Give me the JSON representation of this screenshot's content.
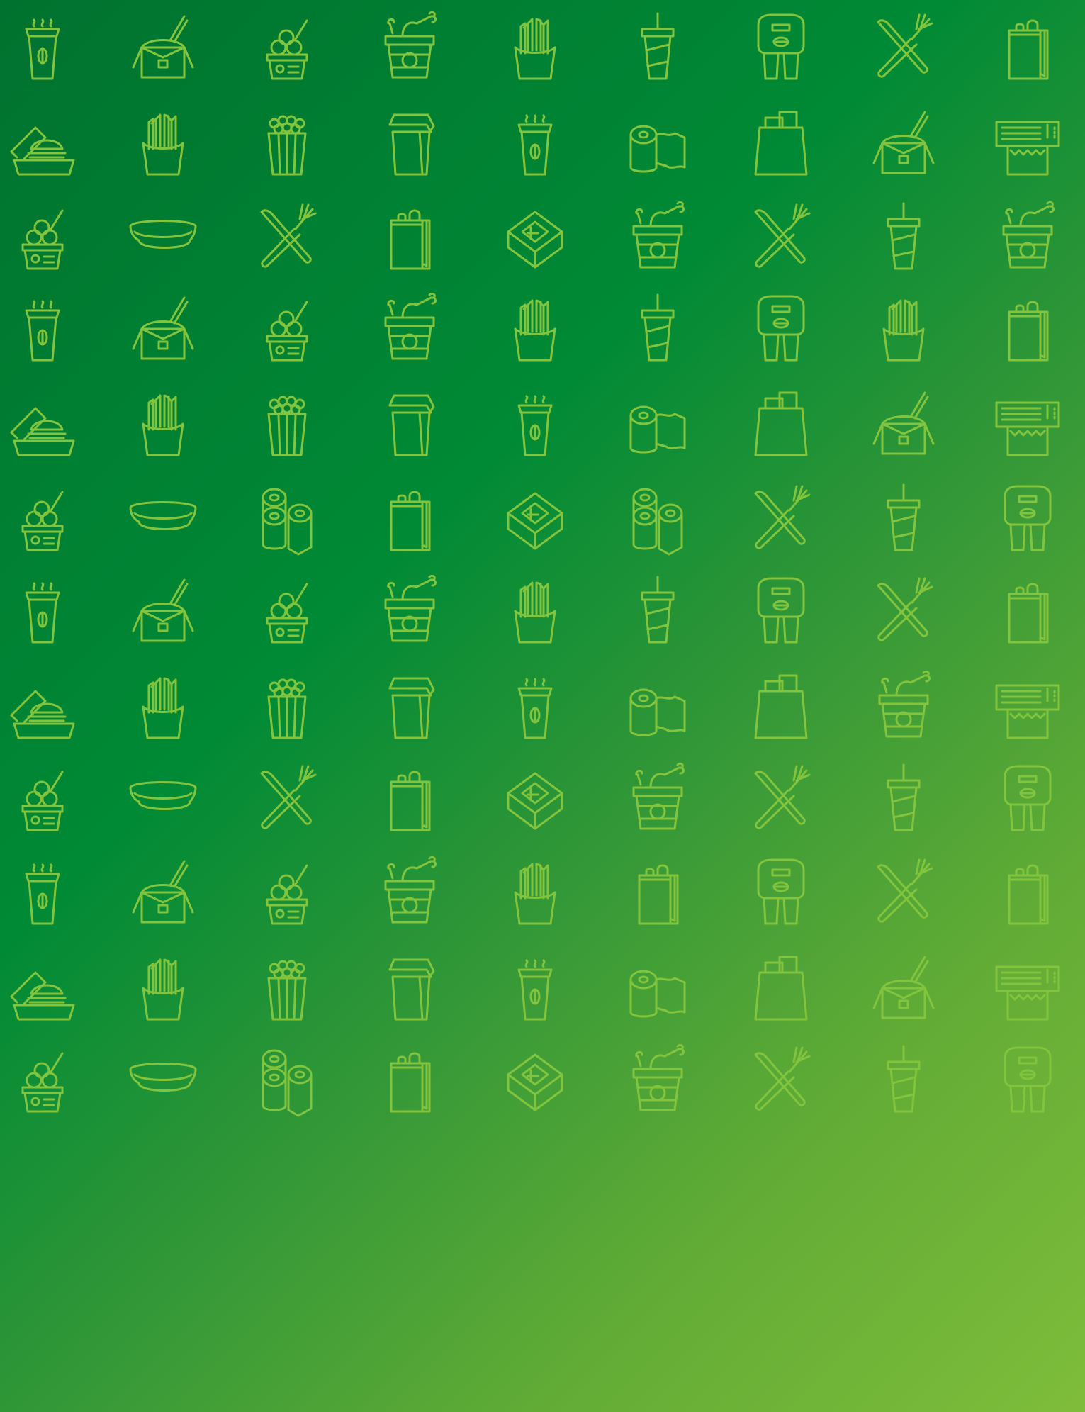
{
  "pattern": {
    "line_color": "#82c43e",
    "background_colors": [
      "#00722f",
      "#008a35",
      "#2e9637",
      "#62ac36",
      "#7fbd3a"
    ],
    "rows": [
      [
        "coffee-cup-icon",
        "noodle-box-icon",
        "ice-cream-cup-icon",
        "chicken-bucket-icon",
        "fries-icon",
        "soda-cup-icon",
        "cup-carrier-icon",
        "knife-fork-icon",
        "paper-bag-icon"
      ],
      [
        "burger-box-icon",
        "fries-icon",
        "popcorn-icon",
        "takeout-box-icon",
        "coffee-cup-icon",
        "paper-towel-icon",
        "shopping-bag-icon",
        "noodle-box-icon",
        "foil-dispenser-icon"
      ],
      [
        "ice-cream-cup-icon",
        "food-tray-icon",
        "knife-fork-icon",
        "paper-bag-icon",
        "pizza-box-icon",
        "chicken-bucket-icon",
        "knife-fork-icon",
        "soda-cup-icon",
        "chicken-bucket-icon"
      ],
      [
        "coffee-cup-icon",
        "noodle-box-icon",
        "ice-cream-cup-icon",
        "chicken-bucket-icon",
        "fries-icon",
        "soda-cup-icon",
        "cup-carrier-icon",
        "fries-icon",
        "paper-bag-icon"
      ],
      [
        "burger-box-icon",
        "fries-icon",
        "popcorn-icon",
        "takeout-box-icon",
        "coffee-cup-icon",
        "paper-towel-icon",
        "shopping-bag-icon",
        "noodle-box-icon",
        "foil-dispenser-icon"
      ],
      [
        "ice-cream-cup-icon",
        "food-tray-icon",
        "paper-towel-rolls-icon",
        "paper-bag-icon",
        "pizza-box-icon",
        "paper-towel-rolls-icon",
        "knife-fork-icon",
        "soda-cup-icon",
        "cup-carrier-icon"
      ],
      [
        "coffee-cup-icon",
        "noodle-box-icon",
        "ice-cream-cup-icon",
        "chicken-bucket-icon",
        "fries-icon",
        "soda-cup-icon",
        "cup-carrier-icon",
        "knife-fork-icon",
        "paper-bag-icon"
      ],
      [
        "burger-box-icon",
        "fries-icon",
        "popcorn-icon",
        "takeout-box-icon",
        "coffee-cup-icon",
        "paper-towel-icon",
        "shopping-bag-icon",
        "chicken-bucket-icon",
        "foil-dispenser-icon"
      ],
      [
        "ice-cream-cup-icon",
        "food-tray-icon",
        "knife-fork-icon",
        "paper-bag-icon",
        "pizza-box-icon",
        "chicken-bucket-icon",
        "knife-fork-icon",
        "soda-cup-icon",
        "cup-carrier-icon"
      ],
      [
        "coffee-cup-icon",
        "noodle-box-icon",
        "ice-cream-cup-icon",
        "chicken-bucket-icon",
        "fries-icon",
        "paper-bag-icon",
        "cup-carrier-icon",
        "knife-fork-icon",
        "paper-bag-icon"
      ],
      [
        "burger-box-icon",
        "fries-icon",
        "popcorn-icon",
        "takeout-box-icon",
        "coffee-cup-icon",
        "paper-towel-icon",
        "shopping-bag-icon",
        "noodle-box-icon",
        "foil-dispenser-icon"
      ],
      [
        "ice-cream-cup-icon",
        "food-tray-icon",
        "paper-towel-rolls-icon",
        "paper-bag-icon",
        "pizza-box-icon",
        "chicken-bucket-icon",
        "knife-fork-icon",
        "soda-cup-icon",
        "cup-carrier-icon"
      ]
    ]
  }
}
